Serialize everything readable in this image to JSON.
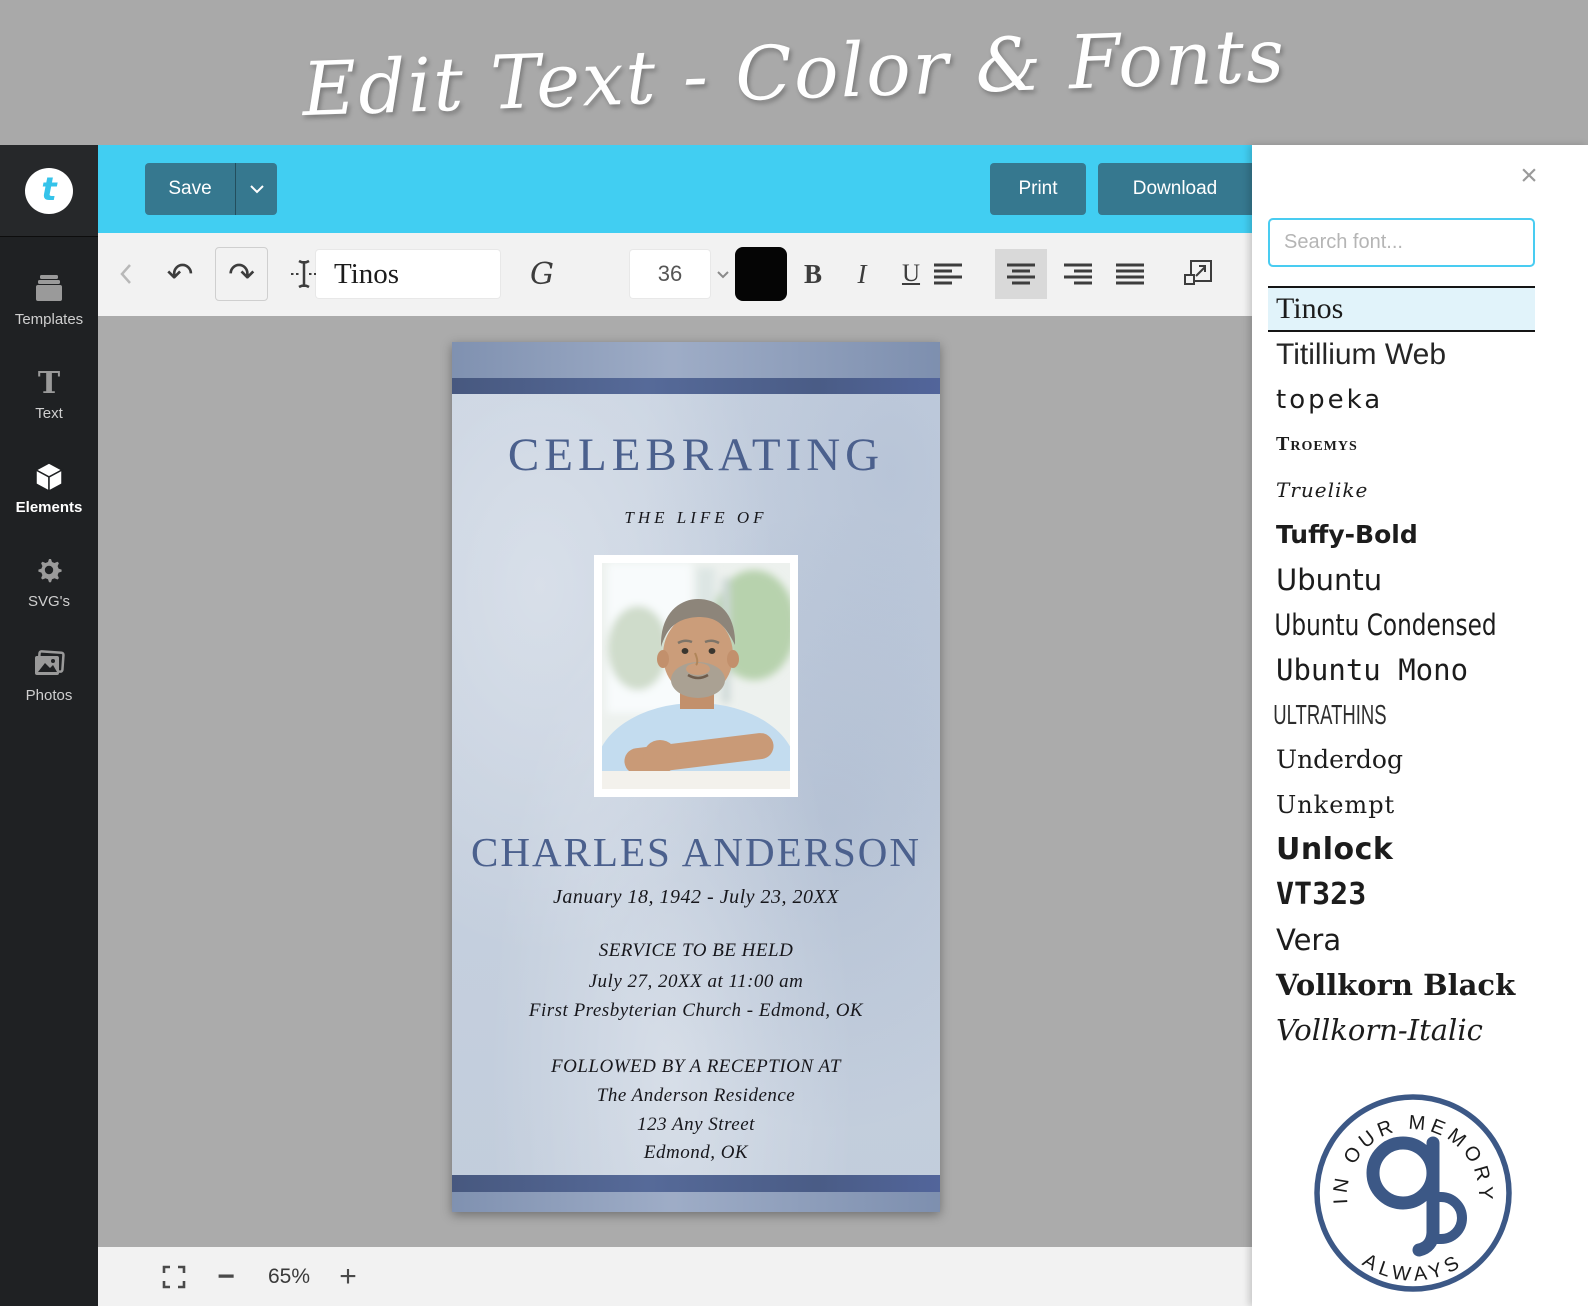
{
  "banner": {
    "title": "Edit Text - Color & Fonts"
  },
  "topbar": {
    "save_label": "Save",
    "print_label": "Print",
    "download_label": "Download"
  },
  "toolbar": {
    "font_name": "Tinos",
    "font_size": "36",
    "font_style_glyph": "G",
    "bold_label": "B",
    "italic_label": "I",
    "underline_label": "U",
    "undo_glyph": "↶",
    "redo_glyph": "↷",
    "color_swatch": "#050505",
    "active_alignment": "center"
  },
  "sidebar": {
    "logo_letter": "t",
    "items": [
      {
        "label": "Templates"
      },
      {
        "label": "Text"
      },
      {
        "label": "Elements"
      },
      {
        "label": "SVG's"
      },
      {
        "label": "Photos"
      }
    ],
    "active_item": "Elements"
  },
  "card": {
    "heading": "CELEBRATING",
    "subheading": "THE LIFE OF",
    "name": "CHARLES ANDERSON",
    "dates": "January 18, 1942 - July 23, 20XX",
    "service_title": "SERVICE TO BE HELD",
    "service_time": "July 27, 20XX at 11:00 am",
    "service_place": "First Presbyterian Church - Edmond, OK",
    "reception_title": "FOLLOWED BY A RECEPTION AT",
    "reception_place": "The Anderson Residence",
    "reception_street": "123 Any Street",
    "reception_city": "Edmond, OK",
    "accent_color": "#4b608d"
  },
  "font_panel": {
    "search_placeholder": "Search font...",
    "close_glyph": "×",
    "selected_font": "Tinos",
    "fonts": [
      {
        "name": "Tinos",
        "style": "serif"
      },
      {
        "name": "Titillium Web",
        "style": "sans"
      },
      {
        "name": "topeka",
        "style": "rounded-sans"
      },
      {
        "name": "Troemys",
        "style": "ornate-smallcaps"
      },
      {
        "name": "Truelike",
        "style": "script"
      },
      {
        "name": "Tuffy-Bold",
        "style": "bold-sans"
      },
      {
        "name": "Ubuntu",
        "style": "sans"
      },
      {
        "name": "Ubuntu Condensed",
        "style": "condensed-sans"
      },
      {
        "name": "Ubuntu Mono",
        "style": "mono"
      },
      {
        "name": "ULTRATHINS",
        "style": "thin-condensed-caps"
      },
      {
        "name": "Underdog",
        "style": "casual-serif"
      },
      {
        "name": "Unkempt",
        "style": "handwritten"
      },
      {
        "name": "Unlock",
        "style": "heavy-sans"
      },
      {
        "name": "VT323",
        "style": "pixel-mono"
      },
      {
        "name": "Vera",
        "style": "sans"
      },
      {
        "name": "Vollkorn Black",
        "style": "heavy-serif"
      },
      {
        "name": "Vollkorn-Italic",
        "style": "italic-serif"
      }
    ]
  },
  "zoombar": {
    "zoom_level": "65%",
    "minus_glyph": "−",
    "plus_glyph": "+"
  },
  "logo_badge": {
    "top_text": "IN OUR MEMORY",
    "bottom_text": "ALWAYS",
    "monogram_color": "#3c5886"
  },
  "colors": {
    "accent_cyan": "#41cef2",
    "button_teal": "#36788f",
    "sidebar_dark": "#1f2123",
    "canvas_gray": "#ababab"
  }
}
